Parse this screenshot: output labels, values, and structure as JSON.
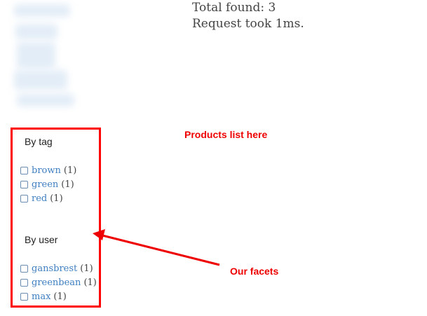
{
  "summary": {
    "total_found": "Total found: 3",
    "request_time": "Request took 1ms."
  },
  "facets": {
    "groups": [
      {
        "title": "By tag",
        "items": [
          {
            "label": "brown",
            "count": "(1)"
          },
          {
            "label": "green",
            "count": "(1)"
          },
          {
            "label": "red",
            "count": "(1)"
          }
        ]
      },
      {
        "title": "By user",
        "items": [
          {
            "label": "gansbrest",
            "count": "(1)"
          },
          {
            "label": "greenbean",
            "count": "(1)"
          },
          {
            "label": "max",
            "count": "(1)"
          }
        ]
      }
    ]
  },
  "annotations": {
    "products_placeholder": "Products list here",
    "facets_label": "Our facets",
    "color": "#ee0000"
  }
}
